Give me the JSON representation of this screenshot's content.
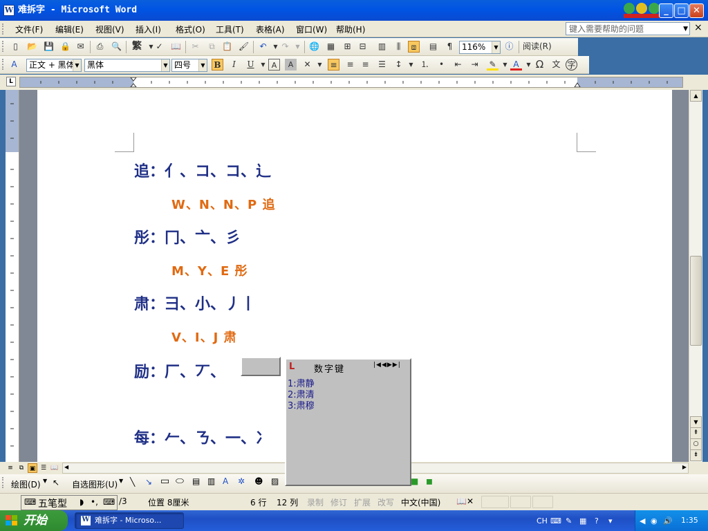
{
  "window": {
    "title": "难拆字 - Microsoft Word",
    "min": "_",
    "max": "□",
    "close": "✕"
  },
  "menu": {
    "items": [
      "文件(F)",
      "编辑(E)",
      "视图(V)",
      "插入(I)",
      "格式(O)",
      "工具(T)",
      "表格(A)",
      "窗口(W)",
      "帮助(H)"
    ],
    "help_placeholder": "键入需要帮助的问题",
    "close_doc": "×"
  },
  "standard_toolbar": {
    "zoom": "116%",
    "read_mode": "阅读(R)",
    "trad": "繁"
  },
  "format_toolbar": {
    "style": "正文 + 黑体",
    "font": "黑体",
    "size": "四号",
    "bold": "B",
    "italic": "I",
    "underline": "U"
  },
  "document": {
    "lines": [
      {
        "text": "追：亻、コ、コ、辶",
        "kind": "radicals"
      },
      {
        "text": "W、N、N、P  追",
        "kind": "codes"
      },
      {
        "text": "彤：冂、亠、彡",
        "kind": "radicals"
      },
      {
        "text": "M、Y、E  彤",
        "kind": "codes"
      },
      {
        "text": "肃：彐、小、丿丨",
        "kind": "radicals"
      },
      {
        "text": "V、I、J  肃",
        "kind": "codes"
      },
      {
        "text": "励：厂、丆、",
        "kind": "radicals"
      },
      {
        "text": "每：𠂉、ㄋ、一、冫",
        "kind": "radicals"
      }
    ]
  },
  "candidate_window": {
    "title": "数字键",
    "candidates": [
      "1:肃静",
      "2:肃清",
      "3:肃穆"
    ]
  },
  "drawing_toolbar": {
    "draw": "绘图(D)",
    "autoshapes": "自选图形(U)"
  },
  "status": {
    "page": "/3",
    "position": "位置 8厘米",
    "line": "6 行",
    "col": "12 列",
    "rec": "录制",
    "trk": "修订",
    "ext": "扩展",
    "ovr": "改写",
    "lang": "中文(中国)"
  },
  "ime": {
    "mode": "五笔型",
    "label": "五笔型"
  },
  "taskbar": {
    "start": "开始",
    "task": "难拆字 - Microso...",
    "clock": "1:35",
    "lang": "CH"
  },
  "colors": {
    "doc_blue": "#1f2f86",
    "doc_orange": "#e06a12",
    "title_blue": "#0054e3"
  }
}
